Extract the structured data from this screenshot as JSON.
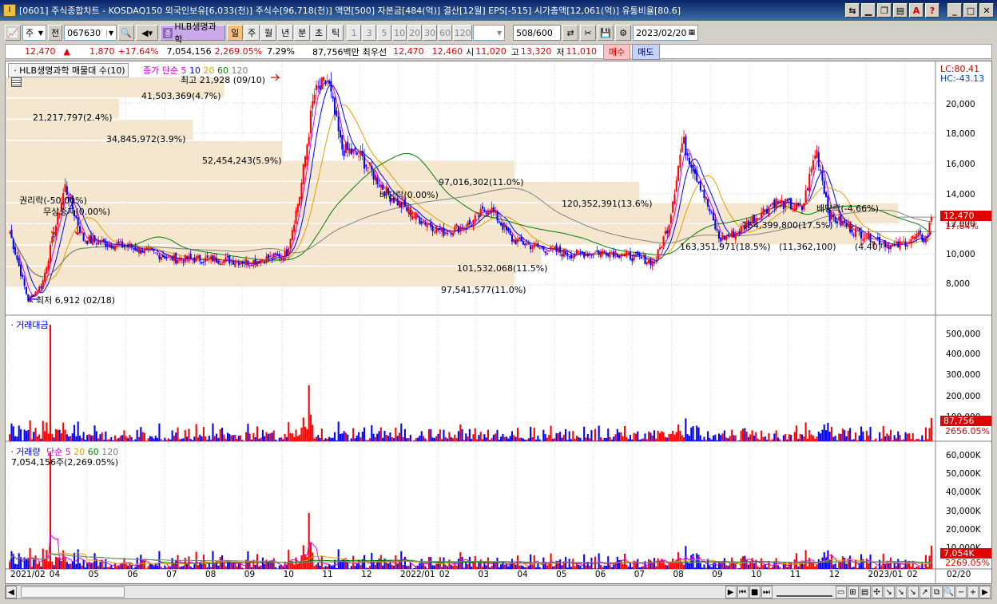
{
  "window": {
    "app_icon": "I",
    "title": "[0601] 주식종합차트 - KOSDAQ150 외국인보유[6,033(천)] 주식수[96,718(천)] 액면[500] 자본금[484(억)] 결산[12월] EPS[-515] 시가총액[12,061(억)] 유통비율[80.6]",
    "tb_icons": [
      "link-icon",
      "minimize-icon",
      "restore-icon",
      "tile-icon",
      "font-icon",
      "help-icon",
      "minimize-icon",
      "maximize-icon",
      "close-icon"
    ]
  },
  "toolbar": {
    "type_select": "주",
    "prev_label": "전",
    "code": "067630",
    "stock_name": "HLB생명과학",
    "periods": [
      "일",
      "주",
      "월",
      "년",
      "분",
      "초",
      "틱"
    ],
    "active_period": "일",
    "intervals": [
      "1",
      "3",
      "5",
      "10",
      "20",
      "30",
      "60",
      "120"
    ],
    "count": "508",
    "count_total": "/600",
    "date": "2023/02/20"
  },
  "quote": {
    "price": "12,470",
    "arrow": "▲",
    "change": "1,870",
    "change_pct": "+17.64%",
    "volume": "7,054,156",
    "volume_pct": "2,269.05%",
    "turnover": "7.29%",
    "amount": "87,756백만",
    "best_label": "최우선",
    "ask": "12,470",
    "bid": "12,460",
    "open_label": "시",
    "open": "11,020",
    "high_label": "고",
    "high": "13,320",
    "low_label": "저",
    "low": "11,010",
    "buy_label": "매수",
    "sell_label": "매도"
  },
  "price_panel": {
    "title": "HLB생명과학 매물대 수(10)",
    "ma_label": "종가 단순",
    "ma_periods": [
      "5",
      "10",
      "20",
      "60",
      "120"
    ],
    "ma_colors": [
      "#e000e0",
      "#0000ff",
      "#e0a000",
      "#008000",
      "#808080"
    ],
    "lc": "LC:80.41",
    "hc": "HC:-43.13",
    "last_price_tag": "12,470",
    "last_pct_tag": "17.64%",
    "high_marker": "최고 21,928 (09/10)",
    "low_marker": "최저 6,912 (02/18)",
    "events": [
      "권리락(-50.00%)",
      "무상증자(0.00%)",
      "배당락(0.00%)",
      "배당락(-4.66%)"
    ],
    "volume_profile": [
      "41,503,369(4.7%)",
      "21,217,797(2.4%)",
      "34,845,972(3.9%)",
      "52,454,243(5.9%)",
      "97,016,302(11.0%)",
      "120,352,391(13.6%)",
      "154,399,800(17.5%)",
      "163,351,971(18.5%)",
      "(11,362,100)",
      "(4.40)",
      "101,532,068(11.5%)",
      "97,541,577(11.0%)"
    ],
    "y_ticks": [
      "20,000",
      "18,000",
      "16,000",
      "14,000",
      "12,000",
      "10,000",
      "8,000"
    ]
  },
  "amount_panel": {
    "title": "거래대금",
    "y_ticks": [
      "500,000",
      "400,000",
      "300,000",
      "200,000",
      "100,000"
    ],
    "last_tag": "87,756",
    "last_pct_tag": "2656.05%"
  },
  "volume_panel": {
    "title": "거래량",
    "ma_label": "단순",
    "ma_periods": [
      "5",
      "20",
      "60",
      "120"
    ],
    "ma_colors": [
      "#e000e0",
      "#e0a000",
      "#008000",
      "#808080"
    ],
    "value_label": "7,054,156주(2,269.05%)",
    "y_ticks": [
      "60,000K",
      "50,000K",
      "40,000K",
      "30,000K",
      "20,000K",
      "10,000K"
    ],
    "last_tag": "7,054K",
    "last_pct_tag": "2269.05%"
  },
  "x_axis": [
    "2021/02",
    "04",
    "05",
    "06",
    "07",
    "08",
    "09",
    "10",
    "11",
    "12",
    "2022/01",
    "02",
    "03",
    "04",
    "05",
    "06",
    "07",
    "08",
    "09",
    "10",
    "11",
    "12",
    "2023/01",
    "02",
    "02/20"
  ],
  "chart_data": {
    "type": "candlestick",
    "x_range": [
      "2021/02",
      "2023/02/20"
    ],
    "ylim": [
      6000,
      22000
    ],
    "close_waypoints": [
      [
        0,
        11500
      ],
      [
        0.02,
        7000
      ],
      [
        0.035,
        8000
      ],
      [
        0.06,
        14500
      ],
      [
        0.08,
        11000
      ],
      [
        0.13,
        10500
      ],
      [
        0.18,
        9700
      ],
      [
        0.22,
        9700
      ],
      [
        0.26,
        9500
      ],
      [
        0.3,
        10000
      ],
      [
        0.315,
        14000
      ],
      [
        0.33,
        20500
      ],
      [
        0.345,
        21500
      ],
      [
        0.36,
        17000
      ],
      [
        0.38,
        16500
      ],
      [
        0.41,
        14000
      ],
      [
        0.44,
        12500
      ],
      [
        0.47,
        11500
      ],
      [
        0.5,
        12000
      ],
      [
        0.52,
        13200
      ],
      [
        0.545,
        11000
      ],
      [
        0.57,
        10500
      ],
      [
        0.61,
        10000
      ],
      [
        0.65,
        10200
      ],
      [
        0.7,
        9500
      ],
      [
        0.715,
        12000
      ],
      [
        0.73,
        17500
      ],
      [
        0.75,
        14500
      ],
      [
        0.77,
        11000
      ],
      [
        0.79,
        11500
      ],
      [
        0.83,
        13500
      ],
      [
        0.86,
        13000
      ],
      [
        0.875,
        17000
      ],
      [
        0.89,
        12500
      ],
      [
        0.92,
        11500
      ],
      [
        0.94,
        11000
      ],
      [
        0.96,
        10500
      ],
      [
        0.985,
        11200
      ],
      [
        0.995,
        11000
      ],
      [
        1.0,
        12470
      ]
    ]
  }
}
